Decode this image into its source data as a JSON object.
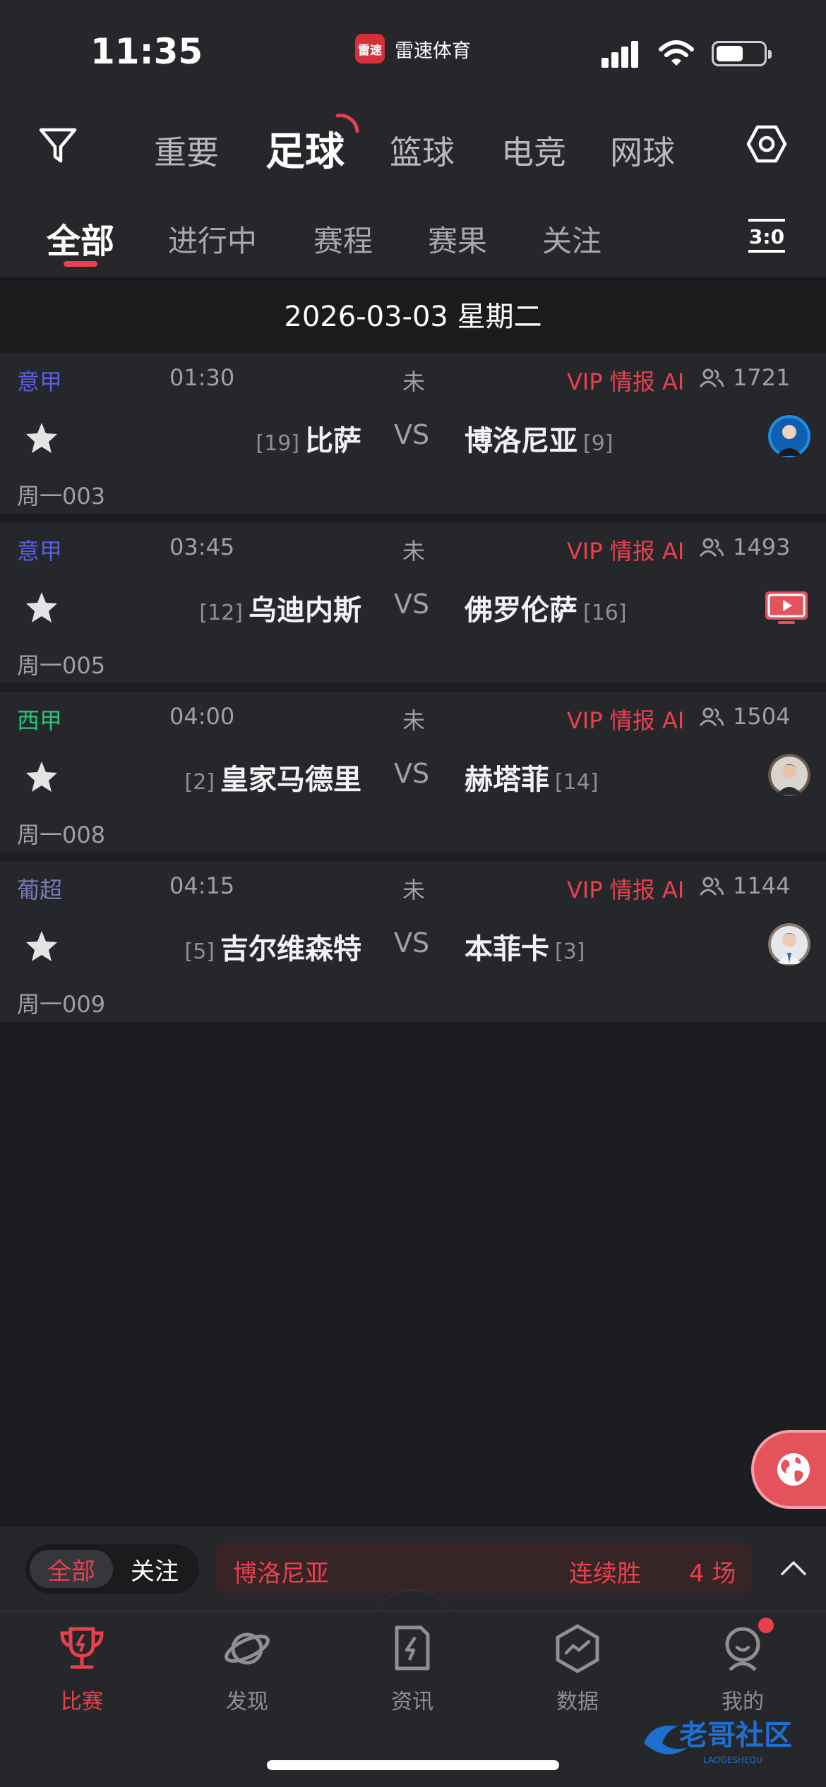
{
  "status_bar": {
    "time": "11:35",
    "app_name": "雷速体育",
    "app_logo_text": "雷速",
    "battery_level": 0.58
  },
  "sport_nav": {
    "tabs": [
      "重要",
      "足球",
      "篮球",
      "电竞",
      "网球"
    ],
    "active": "足球"
  },
  "status_tabs": {
    "tabs": [
      "全部",
      "进行中",
      "赛程",
      "赛果",
      "关注"
    ],
    "active": "全部",
    "score_icon_label": "3:0"
  },
  "date_header": "2026-03-03 星期二",
  "matches": [
    {
      "league": "意甲",
      "league_color": "#5a5fe0",
      "time": "01:30",
      "state": "未",
      "vip": "VIP 情报 AI",
      "count": "1721",
      "home_rank": "[19]",
      "home": "比萨",
      "vs": "VS",
      "away": "博洛尼亚",
      "away_rank": "[9]",
      "code": "周一003",
      "media": "avatar"
    },
    {
      "league": "意甲",
      "league_color": "#5a5fe0",
      "time": "03:45",
      "state": "未",
      "vip": "VIP 情报 AI",
      "count": "1493",
      "home_rank": "[12]",
      "home": "乌迪内斯",
      "vs": "VS",
      "away": "佛罗伦萨",
      "away_rank": "[16]",
      "code": "周一005",
      "media": "tv"
    },
    {
      "league": "西甲",
      "league_color": "#2bc47a",
      "time": "04:00",
      "state": "未",
      "vip": "VIP 情报 AI",
      "count": "1504",
      "home_rank": "[2]",
      "home": "皇家马德里",
      "vs": "VS",
      "away": "赫塔菲",
      "away_rank": "[14]",
      "code": "周一008",
      "media": "avatar"
    },
    {
      "league": "葡超",
      "league_color": "#7a78b8",
      "time": "04:15",
      "state": "未",
      "vip": "VIP 情报 AI",
      "count": "1144",
      "home_rank": "[5]",
      "home": "吉尔维森特",
      "vs": "VS",
      "away": "本菲卡",
      "away_rank": "[3]",
      "code": "周一009",
      "media": "avatar"
    }
  ],
  "streak_bar": {
    "toggle_on": "全部",
    "toggle_off": "关注",
    "team": "博洛尼亚",
    "label": "连续胜",
    "count": "4 场"
  },
  "tabbar": {
    "items": [
      {
        "label": "比赛",
        "icon": "trophy-icon"
      },
      {
        "label": "发现",
        "icon": "planet-icon"
      },
      {
        "label": "资讯",
        "icon": "news-icon"
      },
      {
        "label": "数据",
        "icon": "data-icon"
      },
      {
        "label": "我的",
        "icon": "profile-icon"
      }
    ],
    "active": "比赛"
  },
  "watermark": {
    "text": "老哥社区",
    "subtext": "LAOGESHEQU"
  },
  "colors": {
    "accent": "#e8414d",
    "background": "#1c1d20",
    "card": "#25272b"
  }
}
